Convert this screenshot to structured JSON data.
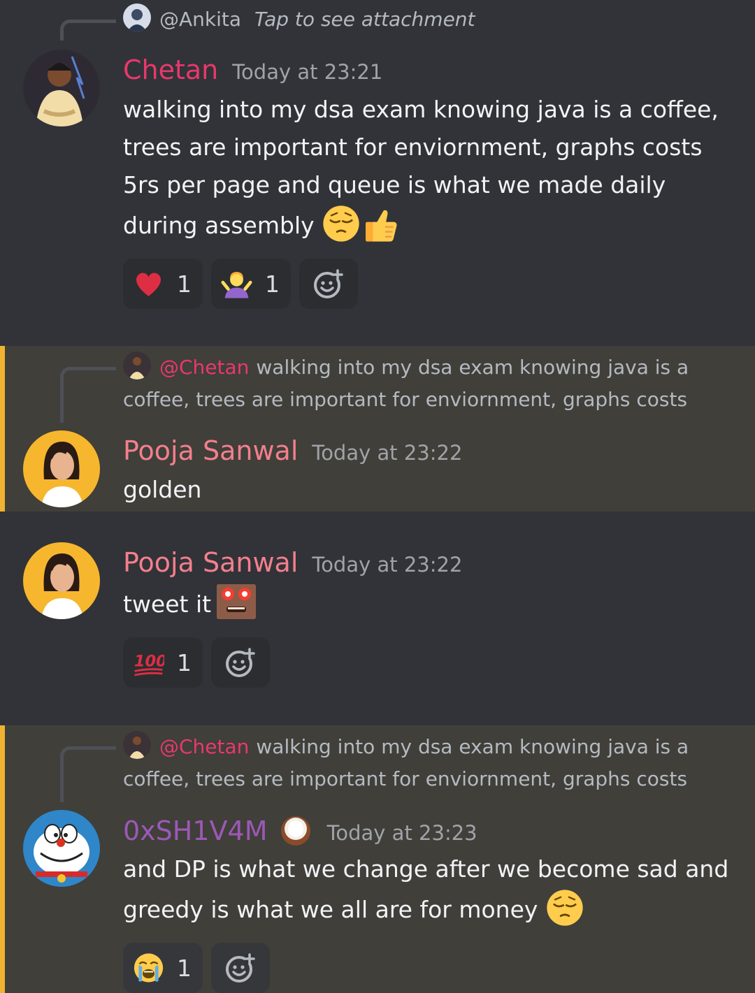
{
  "colors": {
    "bg": "#313338",
    "highlight_bg": "#403f3a",
    "highlight_bar": "#f0b232",
    "chetan": "#e9386c",
    "pooja": "#f47f8d",
    "shivam": "#9b59b6",
    "timestamp": "#a0a3a8"
  },
  "messages": [
    {
      "reply": {
        "name": "@Ankita",
        "text": "Tap to see attachment"
      },
      "author": "Chetan",
      "timestamp": "Today at 23:21",
      "text": "walking into my dsa exam knowing java is a coffee, trees are important for enviornment, graphs costs 5rs per page and queue is what we made daily during assembly",
      "emojis": [
        "pensive-face",
        "thumbs-up"
      ],
      "reactions": [
        {
          "emoji": "red-heart",
          "count": "1"
        },
        {
          "emoji": "person-shrugging",
          "count": "1"
        }
      ]
    },
    {
      "reply": {
        "name": "@Chetan",
        "text": "walking into my dsa exam knowing java is a coffee, trees are important for enviornment, graphs costs"
      },
      "author": "Pooja Sanwal",
      "timestamp": "Today at 23:22",
      "text": "golden"
    },
    {
      "author": "Pooja Sanwal",
      "timestamp": "Today at 23:22",
      "text": "tweet it",
      "reactions": [
        {
          "emoji": "hundred-points",
          "count": "1"
        }
      ]
    },
    {
      "reply": {
        "name": "@Chetan",
        "text": "walking into my dsa exam knowing java is a coffee, trees are important for enviornment, graphs costs"
      },
      "author": "0xSH1V4M",
      "author_badge": "coconut",
      "timestamp": "Today at 23:23",
      "text": "and DP is what we change after we become sad and greedy is what we all are for money",
      "emojis": [
        "pensive-face"
      ],
      "reactions": [
        {
          "emoji": "loudly-crying-face",
          "count": "1"
        }
      ]
    }
  ]
}
